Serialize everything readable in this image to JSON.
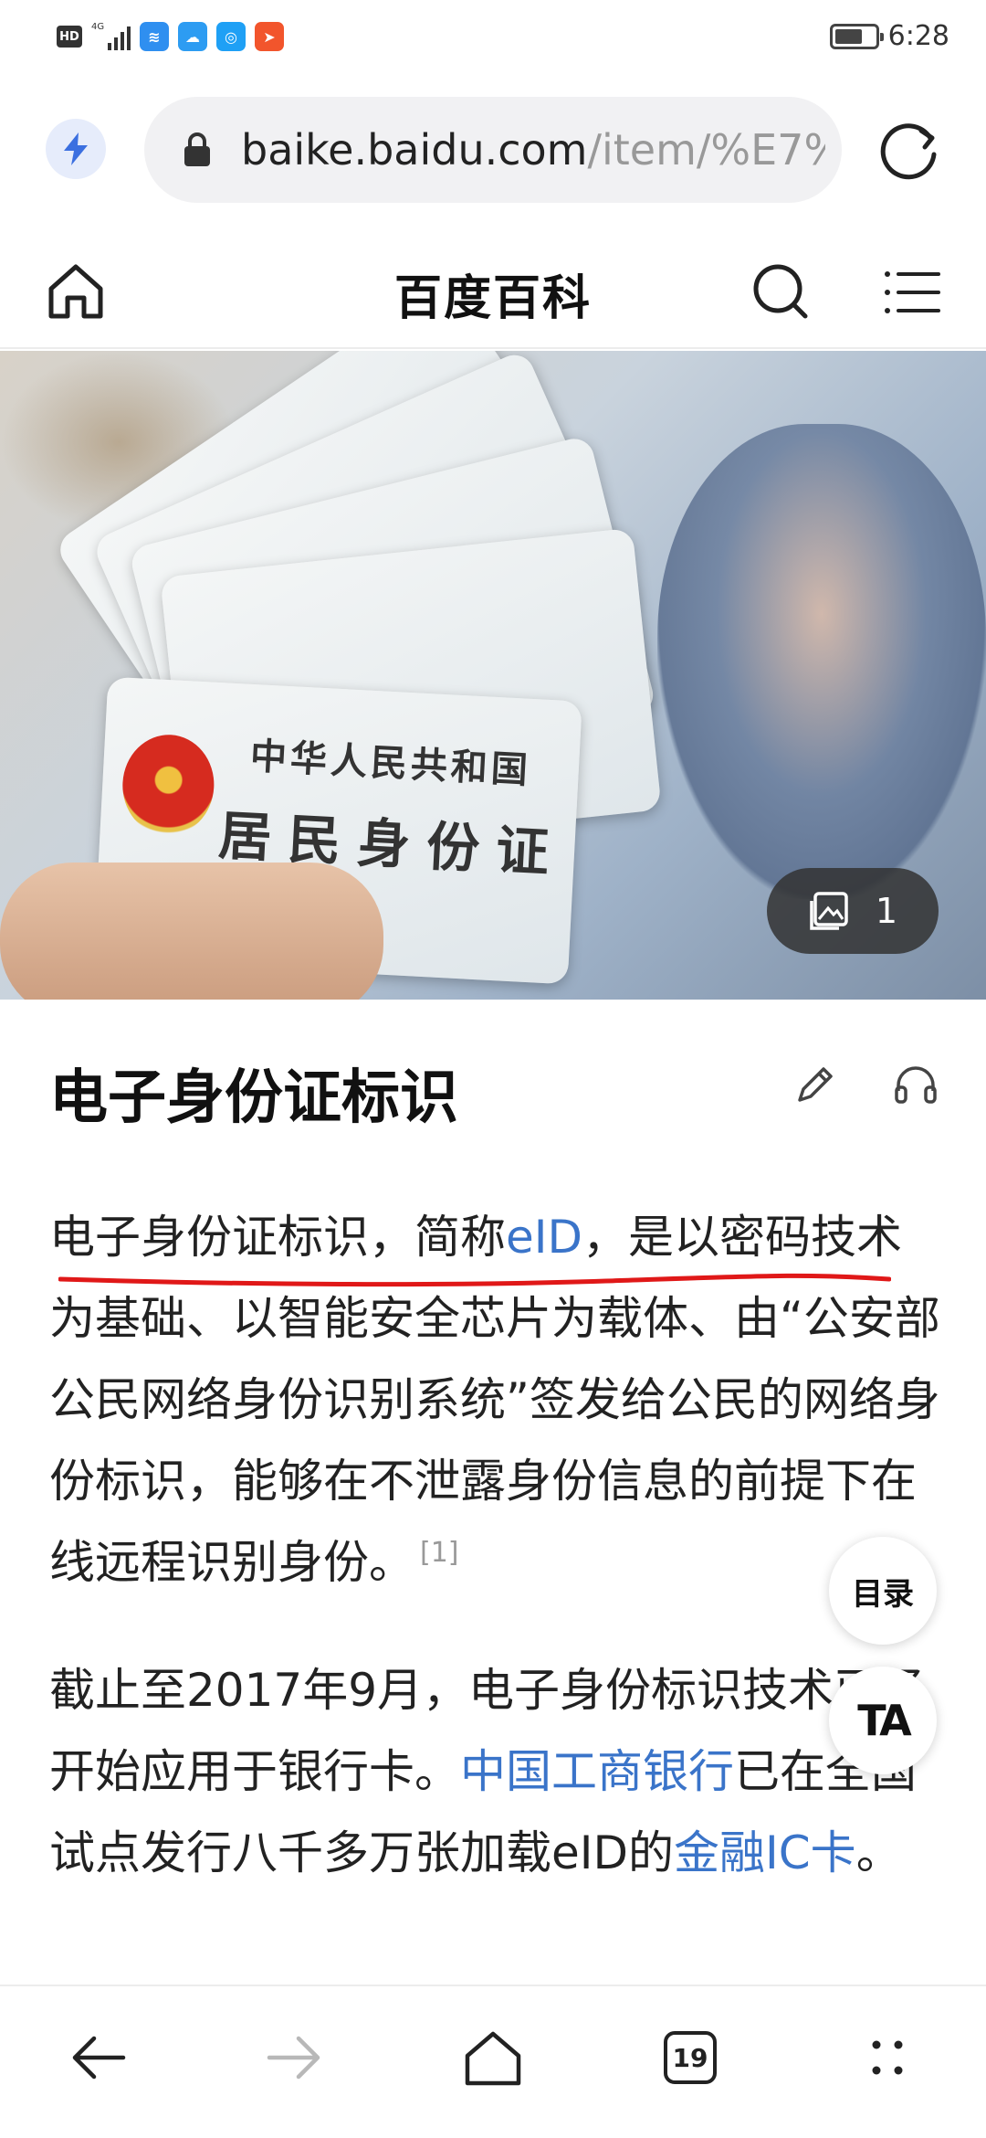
{
  "status_bar": {
    "network_badge": "HD",
    "network_type": "4G",
    "time": "6:28",
    "battery_level": 0.7
  },
  "browser": {
    "url_domain": "baike.baidu.com",
    "url_path": "/item/%E7%9",
    "accent_color": "#3a74c9"
  },
  "site": {
    "title": "百度百科"
  },
  "hero": {
    "card_line1": "中华人民共和国",
    "card_line2": "居民身份证",
    "photo_count": "1"
  },
  "article": {
    "title": "电子身份证标识",
    "para1": {
      "intro": "电子身份证标识，简称",
      "eid_link": "eID",
      "rest": "，是以密码技术为基础、以智能安全芯片为载体、由“公安部公民网络身份识别系统”签发给公民的网络身份标识，能够在不泄露身份信息的前提下在线远程识别身份。",
      "citation": "[1]"
    },
    "para2": {
      "part1": "截止至2017年9月，电子身份标识技术已经开始应用于银行卡。",
      "bank_link": "中国工商银行",
      "part2": "已在全国试点发行八千多万张加载eID的",
      "card_link": "金融IC卡",
      "part3": "。"
    }
  },
  "floating": {
    "toc_label": "目录",
    "ta_label": "TA"
  },
  "bottom_nav": {
    "tab_count": "19"
  }
}
